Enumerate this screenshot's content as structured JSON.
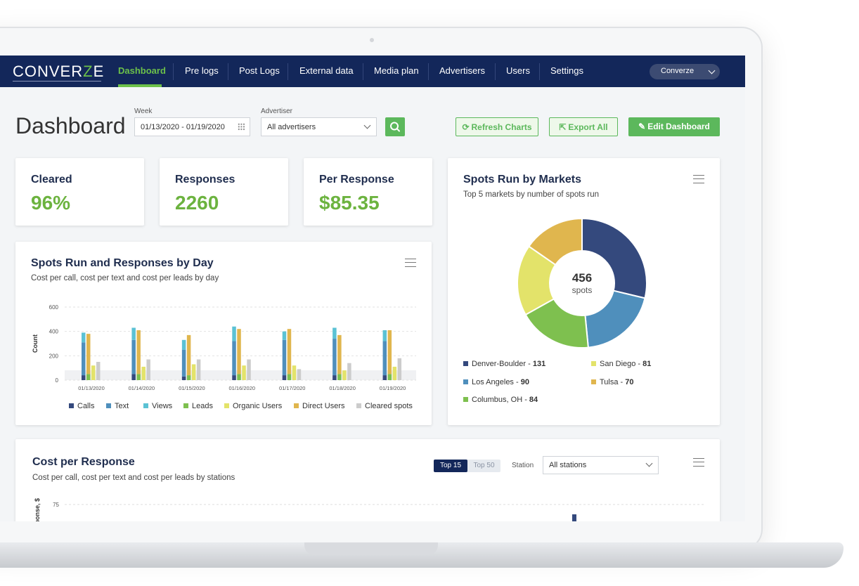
{
  "brand": {
    "logo_pre": "CONVER",
    "logo_z": "Z",
    "logo_post": "E"
  },
  "nav": {
    "items": [
      "Dashboard",
      "Pre logs",
      "Post Logs",
      "External data",
      "Media plan",
      "Advertisers",
      "Users",
      "Settings"
    ],
    "active": "Dashboard",
    "account": "Converze"
  },
  "toolbar": {
    "title": "Dashboard",
    "week_label": "Week",
    "week_value": "01/13/2020 - 01/19/2020",
    "advertiser_label": "Advertiser",
    "advertiser_value": "All advertisers",
    "refresh_label": "Refresh Charts",
    "export_label": "Export All",
    "edit_label": "Edit Dashboard"
  },
  "kpis": [
    {
      "label": "Cleared",
      "value": "96%"
    },
    {
      "label": "Responses",
      "value": "2260"
    },
    {
      "label": "Per Response",
      "value": "$85.35"
    }
  ],
  "spots_by_day": {
    "title": "Spots Run and Responses by Day",
    "subtitle": "Cost per call, cost per text and cost per leads by day"
  },
  "spots_by_markets": {
    "title": "Spots Run by Markets",
    "subtitle": "Top 5 markets by number of spots run",
    "center_value": "456",
    "center_label": "spots"
  },
  "cost_per_response": {
    "title": "Cost per Response",
    "subtitle": "Cost per call, cost per text and cost per leads by stations",
    "toggle_on": "Top 15",
    "toggle_off": "Top 50",
    "station_label": "Station",
    "station_value": "All stations",
    "ylabel": "Cost per response, $",
    "ytick": "75"
  },
  "colors": {
    "navy": "#13275a",
    "green_accent": "#6cb33f",
    "calls": "#34497d",
    "text": "#4f8fbc",
    "views": "#5bc2d4",
    "leads": "#7ec04f",
    "organic": "#e3e36a",
    "direct": "#e0b64e",
    "cleared": "#cccccc"
  },
  "chart_data": [
    {
      "type": "bar",
      "title": "Spots Run and Responses by Day",
      "xlabel": "",
      "ylabel": "Count",
      "ylim": [
        0,
        600
      ],
      "yticks": [
        0,
        200,
        400,
        600
      ],
      "categories": [
        "01/13/2020",
        "01/14/2020",
        "01/15/2020",
        "01/16/2020",
        "01/17/2020",
        "01/18/2020",
        "01/19/2020"
      ],
      "grid": true,
      "legend_position": "bottom",
      "series": [
        {
          "name": "Calls",
          "values": [
            40,
            50,
            30,
            40,
            40,
            40,
            40
          ]
        },
        {
          "name": "Text",
          "values": [
            270,
            280,
            220,
            280,
            290,
            300,
            280
          ]
        },
        {
          "name": "Views",
          "values": [
            80,
            100,
            80,
            120,
            70,
            90,
            90
          ]
        },
        {
          "name": "Leads",
          "values": [
            50,
            50,
            40,
            50,
            50,
            50,
            50
          ]
        },
        {
          "name": "Organic Users",
          "values": [
            120,
            110,
            130,
            120,
            120,
            80,
            110
          ]
        },
        {
          "name": "Direct Users",
          "values": [
            330,
            360,
            330,
            370,
            370,
            320,
            360
          ]
        },
        {
          "name": "Cleared spots",
          "values": [
            150,
            170,
            170,
            170,
            90,
            140,
            180
          ]
        }
      ]
    },
    {
      "type": "pie",
      "title": "Spots Run by Markets",
      "donut": true,
      "total": 456,
      "categories": [
        "Denver-Boulder",
        "Los Angeles",
        "Columbus, OH",
        "San Diego",
        "Tulsa"
      ],
      "values": [
        131,
        90,
        84,
        81,
        70
      ],
      "colors": [
        "#34497d",
        "#4f8fbc",
        "#7ec04f",
        "#e3e36a",
        "#e0b64e"
      ],
      "legend_position": "bottom"
    }
  ]
}
